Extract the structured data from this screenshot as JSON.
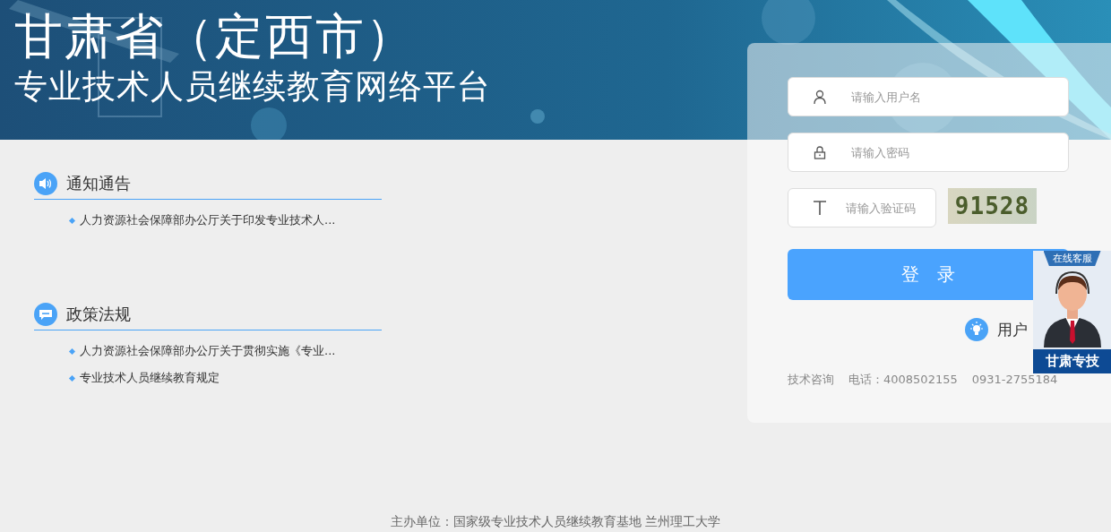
{
  "header": {
    "title": "甘肃省（定西市）",
    "subtitle": "专业技术人员继续教育网络平台"
  },
  "sections": [
    {
      "kind": "notice",
      "title": "通知通告",
      "items": [
        "人力资源社会保障部办公厅关于印发专业技术人..."
      ]
    },
    {
      "kind": "policy",
      "title": "政策法规",
      "items": [
        "人力资源社会保障部办公厅关于贯彻实施《专业...",
        "专业技术人员继续教育规定"
      ]
    }
  ],
  "login": {
    "username": {
      "placeholder": "请输入用户名"
    },
    "password": {
      "placeholder": "请输入密码"
    },
    "captcha": {
      "placeholder": "请输入验证码",
      "code": "91528"
    },
    "submit": "登　录",
    "help": "用户",
    "contact": {
      "label": "技术咨询",
      "phone_label": "电话：",
      "phone1": "4008502155",
      "phone2": "0931-2755184"
    }
  },
  "service_widget": {
    "top": "在线客服",
    "bottom": "甘肃专技"
  },
  "footer": "主办单位：国家级专业技术人员继续教育基地 兰州理工大学"
}
